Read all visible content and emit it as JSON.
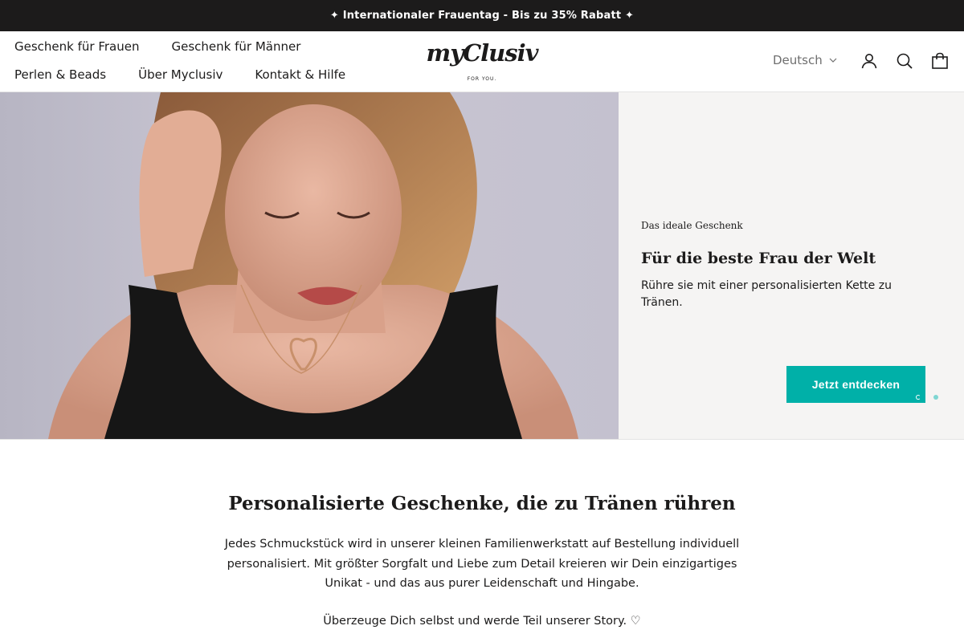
{
  "announcement": "✦ Internationaler Frauentag - Bis zu 35% Rabatt ✦",
  "nav": {
    "row1": [
      "Geschenk für Frauen",
      "Geschenk für Männer"
    ],
    "row2": [
      "Perlen & Beads",
      "Über Myclusiv",
      "Kontakt & Hilfe"
    ]
  },
  "logo": {
    "script": "myClusiv",
    "tagline": "FOR YOU."
  },
  "header": {
    "language": "Deutsch",
    "icons": [
      "user-icon",
      "search-icon",
      "bag-icon"
    ]
  },
  "hero": {
    "kicker": "Das ideale Geschenk",
    "title": "Für die beste Frau der Welt",
    "text": "Rühre sie mit einer personalisierten Kette zu Tränen.",
    "cta": "Jetzt entdecken",
    "slide_count": 2,
    "active_slide": 1
  },
  "intro": {
    "title": "Personalisierte Geschenke, die zu Tränen rühren",
    "text": "Jedes Schmuckstück wird in unserer kleinen Familienwerkstatt auf Bestellung individuell personalisiert. Mit größter Sorgfalt und Liebe zum Detail kreieren wir Dein einzigartiges Unikat - und das aus purer Leidenschaft und Hingabe.",
    "story": "Überzeuge Dich selbst und werde Teil unserer Story. ♡"
  },
  "colors": {
    "accent": "#00b0a8",
    "announcement_bg": "#1c1b1b",
    "panel_bg": "#f5f4f3"
  }
}
